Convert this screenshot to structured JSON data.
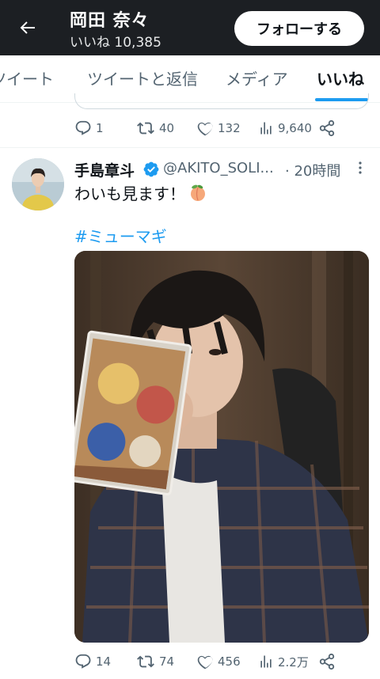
{
  "header": {
    "title": "岡田 奈々",
    "subtitle": "いいね 10,385",
    "follow_label": "フォローする"
  },
  "tabs": [
    {
      "label": "ツイート"
    },
    {
      "label": "ツイートと返信"
    },
    {
      "label": "メディア"
    },
    {
      "label": "いいね",
      "active": true
    }
  ],
  "prev_tweet": {
    "replies": "1",
    "retweets": "40",
    "likes": "132",
    "views": "9,640"
  },
  "tweet": {
    "author_name": "手島章斗",
    "handle": "@AKITO_SOLI...",
    "time": "· 20時間",
    "text": "わいも見ます！",
    "emoji": "peach",
    "hashtag": "#ミューマギ",
    "replies": "14",
    "retweets": "74",
    "likes": "456",
    "views": "2.2万"
  },
  "colors": {
    "header_bg": "#1c1f23",
    "accent": "#1d9bf0",
    "muted": "#536471",
    "text": "#0f1419"
  },
  "icons": [
    "back-arrow-icon",
    "verified-badge-icon",
    "more-options-icon",
    "reply-icon",
    "retweet-icon",
    "like-icon",
    "views-icon",
    "share-icon",
    "peach-emoji-icon"
  ]
}
